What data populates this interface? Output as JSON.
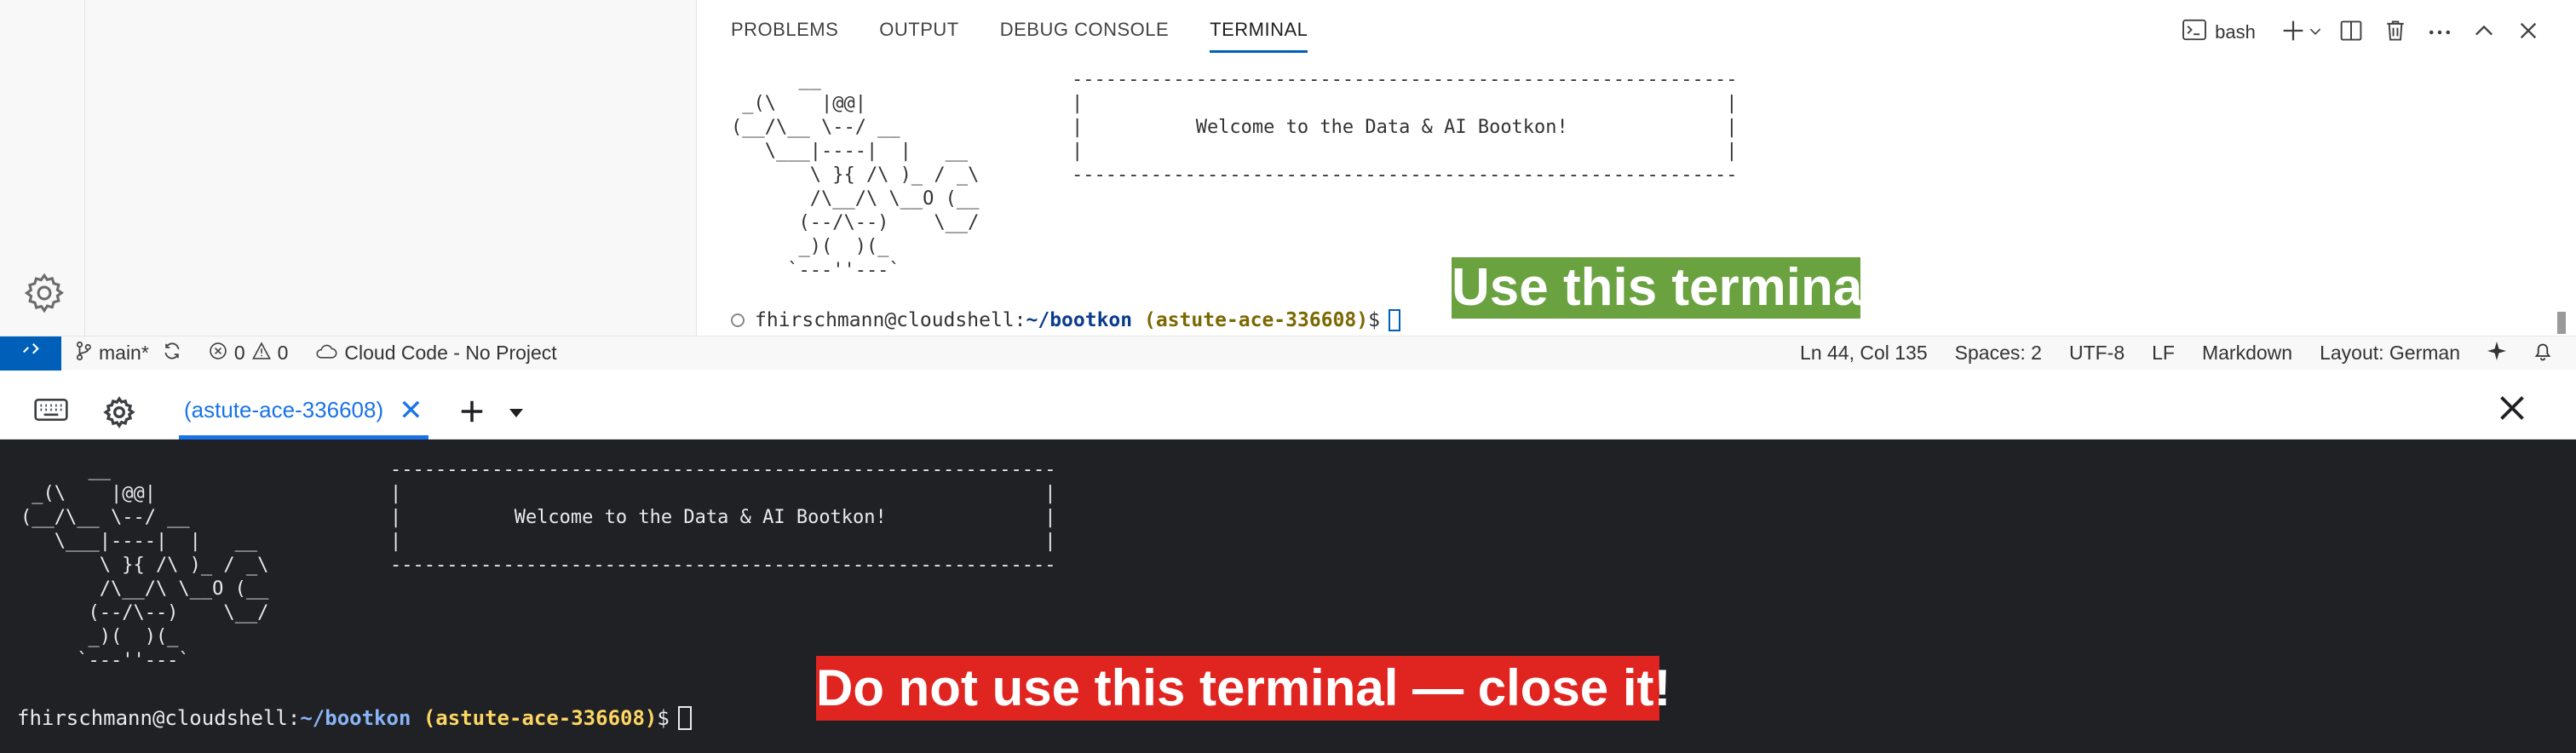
{
  "panel": {
    "tabs": [
      {
        "label": "PROBLEMS",
        "active": false
      },
      {
        "label": "OUTPUT",
        "active": false
      },
      {
        "label": "DEBUG CONSOLE",
        "active": false
      },
      {
        "label": "TERMINAL",
        "active": true
      }
    ],
    "bash_label": "bash",
    "terminal": {
      "ascii_art": "      __\n _(\\    |@@|\n(__/\\__ \\--/ __\n   \\___|----|  |   __\n       \\ }{ /\\ )_ / _\\\n       /\\__/\\ \\__O (__\n      (--/\\--)    \\__/\n      _)(  )(_\n     `---''---`",
      "banner": "-----------------------------------------------------------\n|                                                         |\n|          Welcome to the Data & AI Bootkon!              |\n|                                                         |\n-----------------------------------------------------------",
      "prompt_user": "fhirschmann@cloudshell:",
      "prompt_path": "~/bootkon",
      "prompt_project": "(astute-ace-336608)",
      "prompt_symbol": "$"
    }
  },
  "callouts": {
    "green": "Use this terminal",
    "red": "Do not use this terminal — close it!"
  },
  "statusbar": {
    "branch": "main*",
    "errors": "0",
    "warnings": "0",
    "cloud_code": "Cloud Code - No Project",
    "position": "Ln 44, Col 135",
    "spaces": "Spaces: 2",
    "encoding": "UTF-8",
    "eol": "LF",
    "language": "Markdown",
    "layout": "Layout: German"
  },
  "cloudshell": {
    "tab_label": "(astute-ace-336608)",
    "tab_close": "✕",
    "terminal": {
      "ascii_art": "      __\n _(\\    |@@|\n(__/\\__ \\--/ __\n   \\___|----|  |   __\n       \\ }{ /\\ )_ / _\\\n       /\\__/\\ \\__O (__\n      (--/\\--)    \\__/\n      _)(  )(_\n     `---''---`",
      "banner": "-----------------------------------------------------------\n|                                                         |\n|          Welcome to the Data & AI Bootkon!              |\n|                                                         |\n-----------------------------------------------------------",
      "prompt_user": "fhirschmann@cloudshell:",
      "prompt_path": "~/bootkon",
      "prompt_project": "(astute-ace-336608)",
      "prompt_symbol": "$"
    }
  },
  "colors": {
    "accent_blue": "#005fb8",
    "callout_green": "#6aa240",
    "callout_red": "#e02521",
    "terminal_bg": "#202124"
  }
}
